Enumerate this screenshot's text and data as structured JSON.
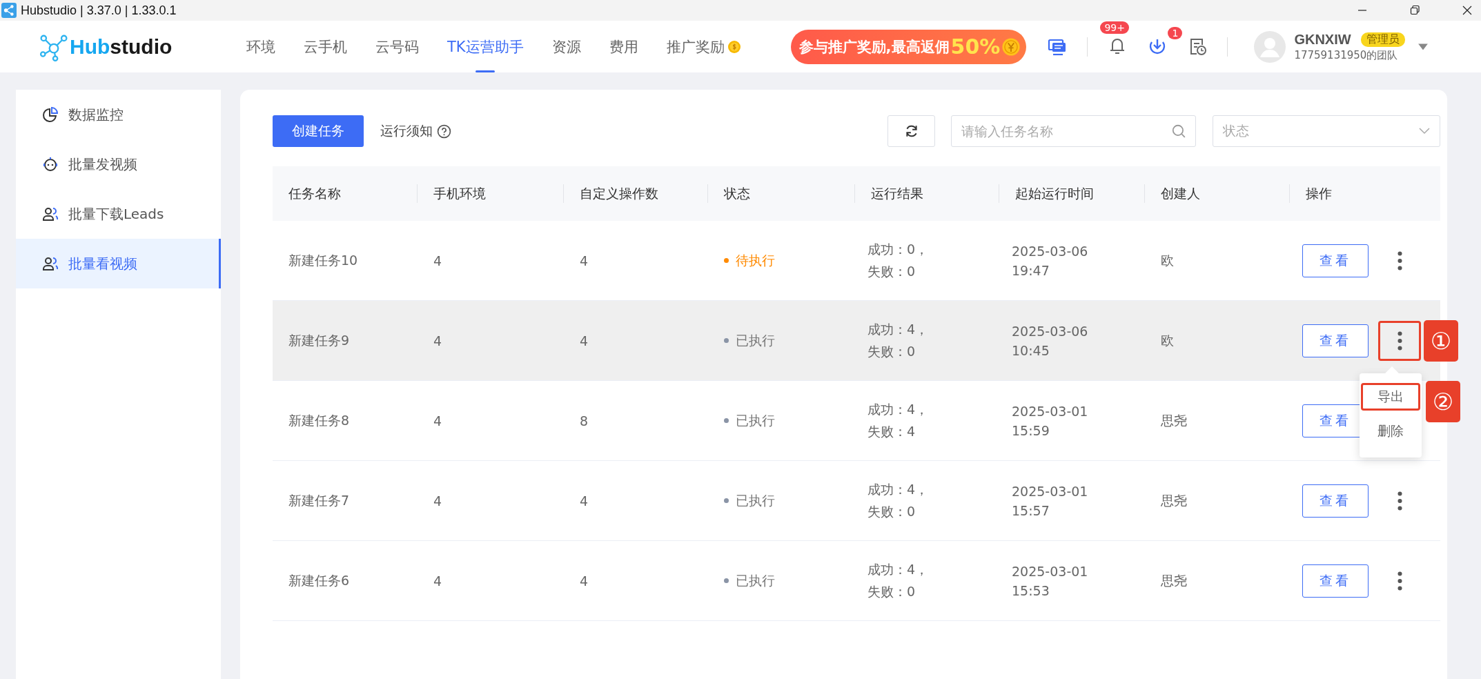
{
  "window": {
    "title": "Hubstudio | 3.37.0 | 1.33.0.1"
  },
  "logo": {
    "accent": "Hub",
    "text": "studio"
  },
  "nav": [
    {
      "label": "环境",
      "selected": false,
      "coin": false
    },
    {
      "label": "云手机",
      "selected": false,
      "coin": false
    },
    {
      "label": "云号码",
      "selected": false,
      "coin": false
    },
    {
      "label": "TK运营助手",
      "selected": true,
      "coin": false
    },
    {
      "label": "资源",
      "selected": false,
      "coin": false
    },
    {
      "label": "费用",
      "selected": false,
      "coin": false
    },
    {
      "label": "推广奖励",
      "selected": false,
      "coin": true
    }
  ],
  "promo": {
    "text": "参与推广奖励,最高返佣",
    "highlight": "50%"
  },
  "notifications": {
    "badge": "99+"
  },
  "downloads": {
    "badge": "1"
  },
  "user": {
    "name": "GKNXIW",
    "role": "管理员",
    "team": "17759131950的团队"
  },
  "sidebar": {
    "items": [
      {
        "label": "数据监控",
        "selected": false
      },
      {
        "label": "批量发视频",
        "selected": false
      },
      {
        "label": "批量下载Leads",
        "selected": false
      },
      {
        "label": "批量看视频",
        "selected": true
      }
    ]
  },
  "toolbar": {
    "create": "创建任务",
    "notice": "运行须知",
    "search": {
      "placeholder": "请输入任务名称"
    },
    "status": {
      "placeholder": "状态"
    }
  },
  "table": {
    "columns": [
      "任务名称",
      "手机环境",
      "自定义操作数",
      "状态",
      "运行结果",
      "起始运行时间",
      "创建人",
      "操作"
    ],
    "rows": [
      {
        "name": "新建任务10",
        "phones": "4",
        "ops": "4",
        "status": {
          "label": "待执行",
          "kind": "pending"
        },
        "result": [
          "成功：0，",
          "失败：0"
        ],
        "time": [
          "2025-03-06",
          "19:47"
        ],
        "creator": "欧",
        "action": "查看",
        "highlighted": false
      },
      {
        "name": "新建任务9",
        "phones": "4",
        "ops": "4",
        "status": {
          "label": "已执行",
          "kind": "done"
        },
        "result": [
          "成功：4，",
          "失败：0"
        ],
        "time": [
          "2025-03-06",
          "10:45"
        ],
        "creator": "欧",
        "action": "查看",
        "highlighted": true,
        "more_annotation": "①",
        "menu": [
          {
            "label": "导出",
            "annotation": "②"
          },
          {
            "label": "删除"
          }
        ]
      },
      {
        "name": "新建任务8",
        "phones": "4",
        "ops": "8",
        "status": {
          "label": "已执行",
          "kind": "done"
        },
        "result": [
          "成功：4，",
          "失败：4"
        ],
        "time": [
          "2025-03-01",
          "15:59"
        ],
        "creator": "思尧",
        "action": "查看",
        "highlighted": false
      },
      {
        "name": "新建任务7",
        "phones": "4",
        "ops": "4",
        "status": {
          "label": "已执行",
          "kind": "done"
        },
        "result": [
          "成功：4，",
          "失败：0"
        ],
        "time": [
          "2025-03-01",
          "15:57"
        ],
        "creator": "思尧",
        "action": "查看",
        "highlighted": false
      },
      {
        "name": "新建任务6",
        "phones": "4",
        "ops": "4",
        "status": {
          "label": "已执行",
          "kind": "done"
        },
        "result": [
          "成功：4，",
          "失败：0"
        ],
        "time": [
          "2025-03-01",
          "15:53"
        ],
        "creator": "思尧",
        "action": "查看",
        "highlighted": false
      }
    ]
  }
}
